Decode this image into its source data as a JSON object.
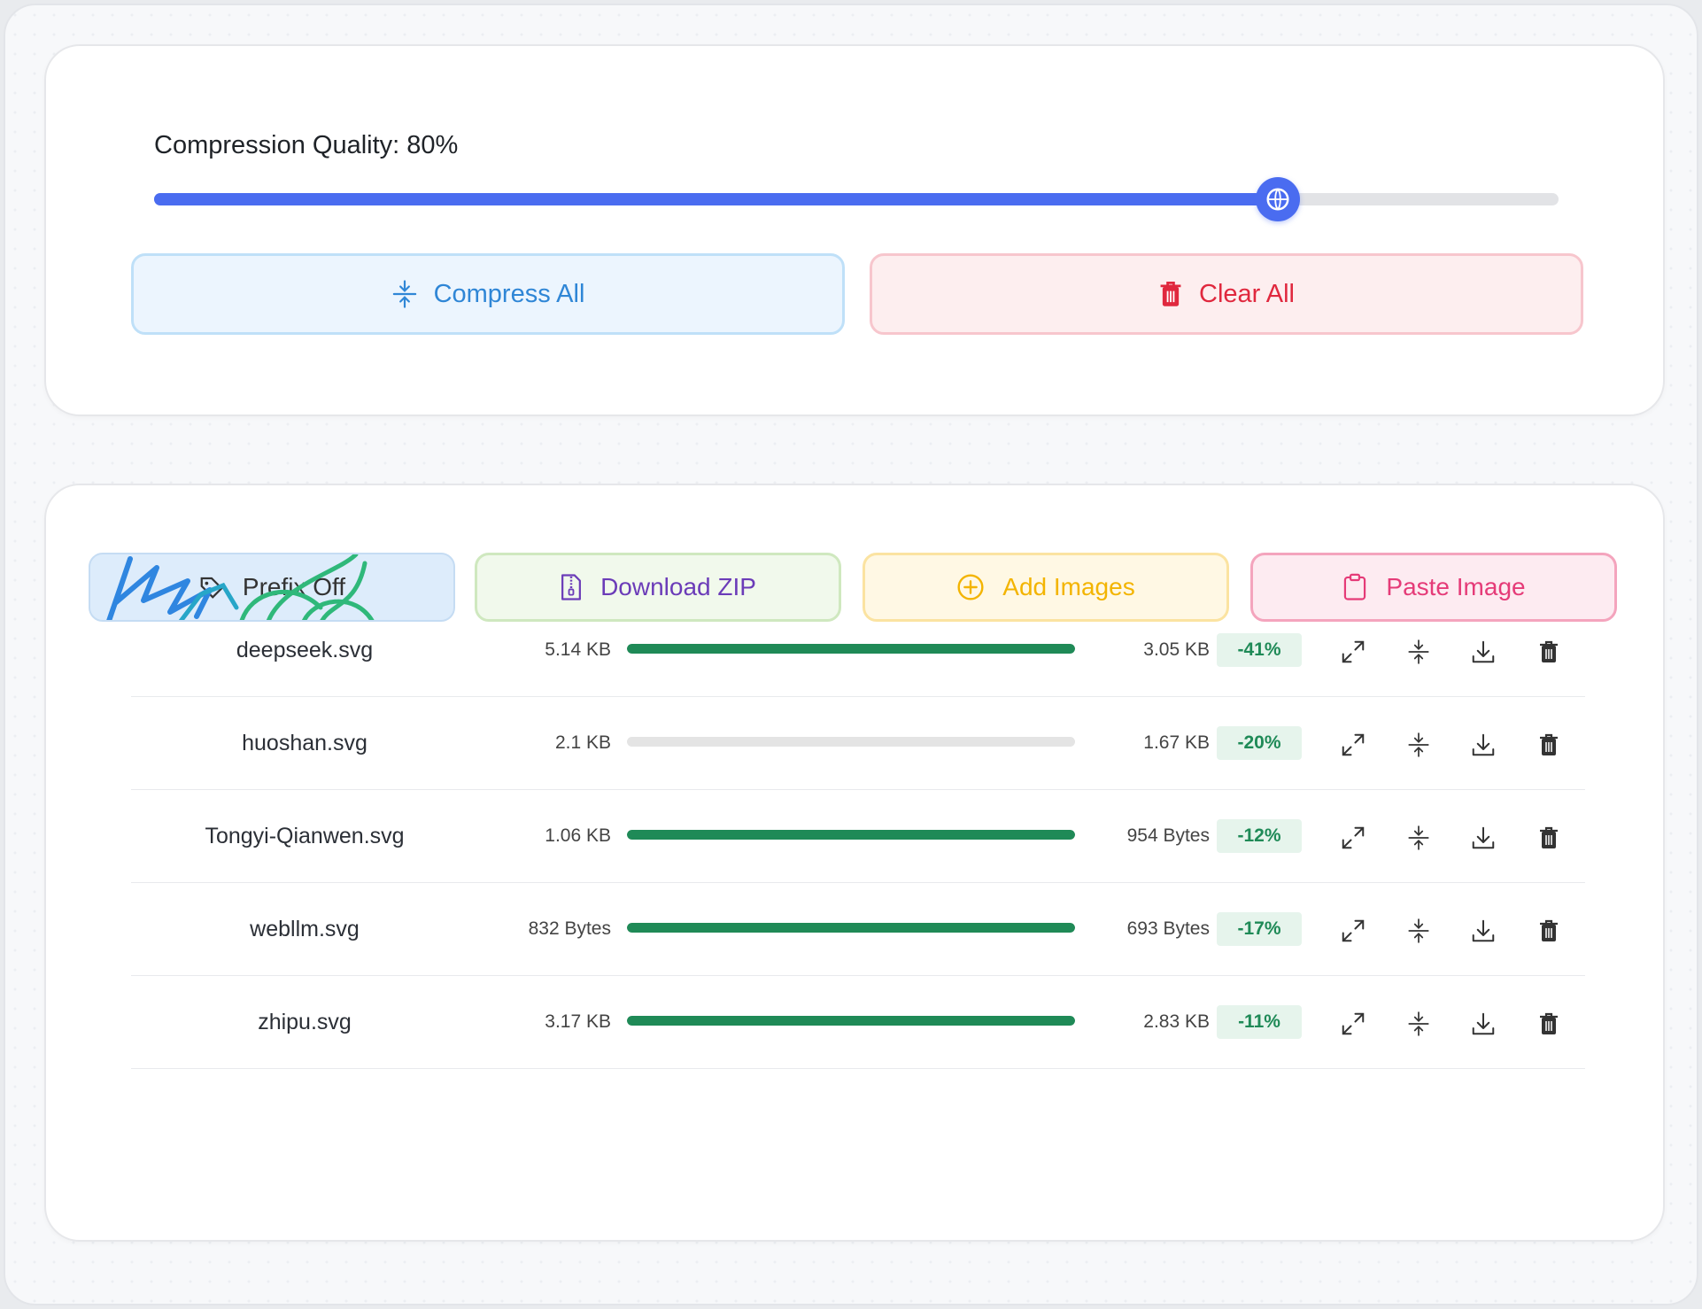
{
  "settings": {
    "quality_label": "Compression Quality:",
    "quality_value": "80%",
    "quality_fraction": 0.8,
    "compress_all_label": "Compress All",
    "clear_all_label": "Clear All"
  },
  "actions": {
    "prefix_label": "Prefix Off",
    "download_zip_label": "Download ZIP",
    "add_images_label": "Add Images",
    "paste_image_label": "Paste Image"
  },
  "files": [
    {
      "name": "deepseek.svg",
      "original": "5.14 KB",
      "compressed": "3.05 KB",
      "change": "-41%",
      "progress": 1.0
    },
    {
      "name": "huoshan.svg",
      "original": "2.1 KB",
      "compressed": "1.67 KB",
      "change": "-20%",
      "progress": 0.0
    },
    {
      "name": "Tongyi-Qianwen.svg",
      "original": "1.06 KB",
      "compressed": "954 Bytes",
      "change": "-12%",
      "progress": 1.0
    },
    {
      "name": "webllm.svg",
      "original": "832 Bytes",
      "compressed": "693 Bytes",
      "change": "-17%",
      "progress": 1.0
    },
    {
      "name": "zhipu.svg",
      "original": "3.17 KB",
      "compressed": "2.83 KB",
      "change": "-11%",
      "progress": 1.0
    }
  ],
  "icons": [
    "compress-icon",
    "trash-icon",
    "tag-icon",
    "zip-file-icon",
    "plus-circle-icon",
    "clipboard-icon",
    "expand-icon",
    "download-icon"
  ],
  "colors": {
    "accent": "#4a6cf0",
    "success": "#1f8a57",
    "danger": "#e0283e",
    "info": "#2f86d6"
  }
}
